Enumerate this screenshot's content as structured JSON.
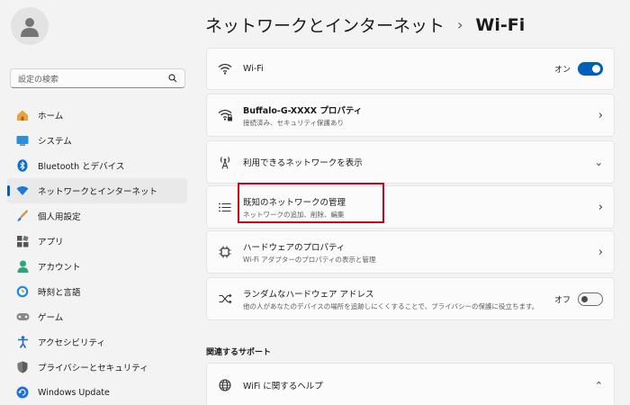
{
  "search": {
    "placeholder": "設定の検索"
  },
  "sidebar": {
    "items": [
      {
        "label": "ホーム",
        "icon": "home-icon"
      },
      {
        "label": "システム",
        "icon": "system-icon"
      },
      {
        "label": "Bluetooth とデバイス",
        "icon": "bluetooth-icon"
      },
      {
        "label": "ネットワークとインターネット",
        "icon": "wifi-icon",
        "active": true
      },
      {
        "label": "個人用設定",
        "icon": "brush-icon"
      },
      {
        "label": "アプリ",
        "icon": "apps-icon"
      },
      {
        "label": "アカウント",
        "icon": "account-icon"
      },
      {
        "label": "時刻と言語",
        "icon": "clock-icon"
      },
      {
        "label": "ゲーム",
        "icon": "gamepad-icon"
      },
      {
        "label": "アクセシビリティ",
        "icon": "accessibility-icon"
      },
      {
        "label": "プライバシーとセキュリティ",
        "icon": "shield-icon"
      },
      {
        "label": "Windows Update",
        "icon": "update-icon"
      }
    ]
  },
  "header": {
    "parent": "ネットワークとインターネット",
    "separator": "›",
    "current": "Wi-Fi"
  },
  "cards": {
    "wifi": {
      "title": "Wi-Fi",
      "state": "オン"
    },
    "props": {
      "title": "Buffalo-G-XXXX プロパティ",
      "sub": "接続済み、セキュリティ保護あり"
    },
    "available": {
      "title": "利用できるネットワークを表示"
    },
    "known": {
      "title": "既知のネットワークの管理",
      "sub": "ネットワークの追加、削除、編集"
    },
    "hardware": {
      "title": "ハードウェアのプロパティ",
      "sub": "Wi-Fi アダプターのプロパティの表示と管理"
    },
    "random": {
      "title": "ランダムなハードウェア アドレス",
      "sub": "他の人があなたのデバイスの場所を追跡しにくくすることで、プライバシーの保護に役立ちます。",
      "state": "オフ"
    },
    "help": {
      "title": "WiFi に関するヘルプ"
    }
  },
  "support": {
    "title": "関連するサポート"
  },
  "colors": {
    "accent": "#005fb8",
    "highlight": "#d0021b"
  }
}
